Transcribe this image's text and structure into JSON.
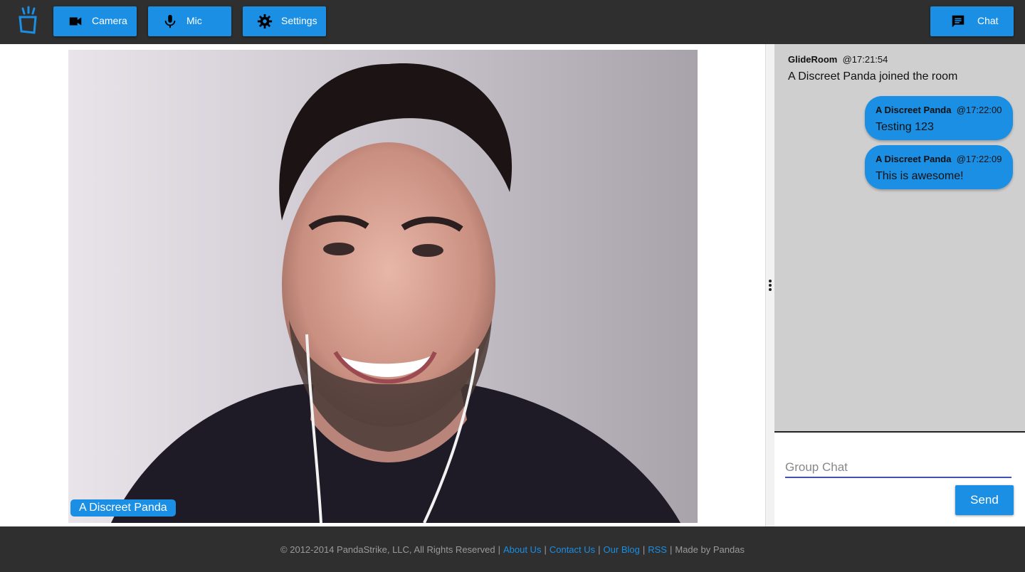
{
  "toolbar": {
    "camera_label": "Camera",
    "mic_label": "Mic",
    "settings_label": "Settings",
    "chat_label": "Chat"
  },
  "video": {
    "participant_name": "A Discreet Panda"
  },
  "chat": {
    "system_message": {
      "sender": "GlideRoom",
      "time": "@17:21:54",
      "text": "A Discreet Panda joined the room"
    },
    "messages": [
      {
        "sender": "A Discreet Panda",
        "time": "@17:22:00",
        "text": "Testing 123"
      },
      {
        "sender": "A Discreet Panda",
        "time": "@17:22:09",
        "text": "This is awesome!"
      }
    ],
    "input_placeholder": "Group Chat",
    "send_label": "Send"
  },
  "footer": {
    "copyright": "© 2012-2014 PandaStrike, LLC, All Rights Reserved",
    "links": [
      "About Us",
      "Contact Us",
      "Our Blog",
      "RSS"
    ],
    "made_by": "Made by Pandas"
  },
  "colors": {
    "accent": "#1a8fe3",
    "topbar": "#2f2f2f",
    "chat_bg": "#cfcfcf"
  }
}
